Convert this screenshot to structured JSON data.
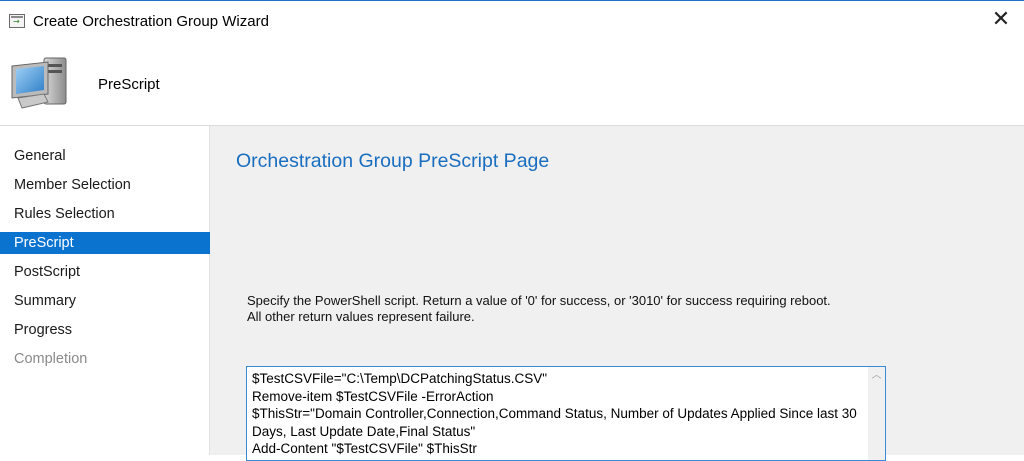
{
  "window": {
    "title": "Create Orchestration Group Wizard",
    "close_symbol": "✕"
  },
  "header": {
    "title": "PreScript",
    "icon": "computer-icon"
  },
  "sidebar": {
    "items": [
      {
        "label": "General",
        "state": "normal"
      },
      {
        "label": "Member Selection",
        "state": "normal"
      },
      {
        "label": "Rules Selection",
        "state": "normal"
      },
      {
        "label": "PreScript",
        "state": "selected"
      },
      {
        "label": "PostScript",
        "state": "normal"
      },
      {
        "label": "Summary",
        "state": "normal"
      },
      {
        "label": "Progress",
        "state": "normal"
      },
      {
        "label": "Completion",
        "state": "disabled"
      }
    ]
  },
  "main": {
    "heading": "Orchestration Group PreScript Page",
    "instructions": "Specify the PowerShell script. Return a value of '0' for success, or '3010' for success requiring reboot.\nAll other return values represent failure.",
    "script": "$TestCSVFile=\"C:\\Temp\\DCPatchingStatus.CSV\"\nRemove-item $TestCSVFile -ErrorAction\n$ThisStr=\"Domain Controller,Connection,Command Status, Number of Updates Applied Since last 30 Days, Last Update Date,Final Status\"\nAdd-Content \"$TestCSVFile\" $ThisStr"
  },
  "colors": {
    "accent": "#0a73cf",
    "heading": "#1a6ec0",
    "content_bg": "#f0f0f0",
    "disabled_text": "#8a8a8a"
  }
}
